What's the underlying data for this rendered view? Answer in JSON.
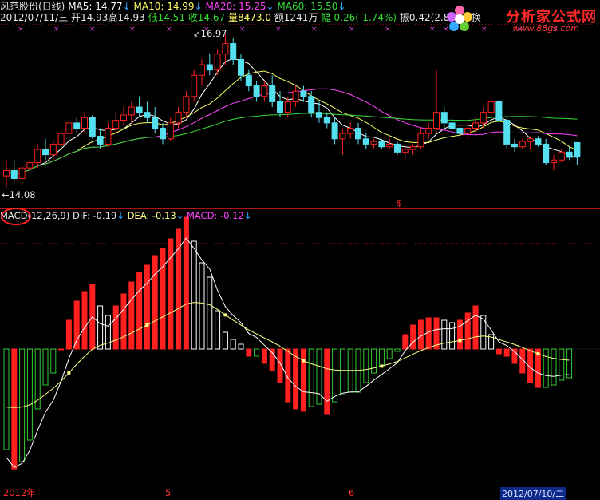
{
  "header": {
    "name": "风范股份(日线)",
    "ma5_label": "MA5: 14.77",
    "ma10_label": "MA10: 14.99",
    "ma20_label": "MA20: 15.25",
    "ma60_label": "MA60: 15.50",
    "date": "2012/07/11/三",
    "open": "开14.93",
    "high": "高14.93",
    "low": "低14.51",
    "close": "收14.67",
    "volume": "量8473.0",
    "amount": "额1241万",
    "change": "幅-0.26(-1.74%)",
    "amplitude": "振0.42(2.81%)",
    "more": "换"
  },
  "logo": {
    "title": "分析家公式网",
    "url": "www.88gs.com"
  },
  "price_panel": {
    "high_label": "16.97",
    "low_label": "←14.08",
    "marker": "$"
  },
  "macd_panel": {
    "name": "MACD",
    "params": "(12,26,9)",
    "dif_label": "DIF: -0.19",
    "dea_label": "DEA: -0.13",
    "macd_label": "MACD: -0.12"
  },
  "axis": {
    "left_date": "2012年",
    "mark_5": "5",
    "mark_6": "6",
    "right_date": "2012/07/10/二"
  },
  "colors": {
    "up": "#ff2020",
    "down": "#55e0f0",
    "ma5": "#ffffff",
    "ma10": "#ffff66",
    "ma20": "#ff44ff",
    "ma60": "#33dd33",
    "dif": "#ffffff",
    "dea": "#ffff88"
  },
  "chart_data": {
    "type": "candlestick+macd",
    "candles": [
      [
        14.3,
        14.6,
        14.08,
        14.4
      ],
      [
        14.4,
        14.6,
        14.2,
        14.25
      ],
      [
        14.25,
        14.5,
        14.1,
        14.45
      ],
      [
        14.45,
        14.7,
        14.35,
        14.55
      ],
      [
        14.55,
        14.9,
        14.45,
        14.8
      ],
      [
        14.8,
        15.0,
        14.6,
        14.7
      ],
      [
        14.7,
        15.0,
        14.6,
        14.9
      ],
      [
        14.9,
        15.2,
        14.8,
        15.1
      ],
      [
        15.1,
        15.4,
        15.0,
        15.3
      ],
      [
        15.3,
        15.4,
        15.1,
        15.2
      ],
      [
        15.2,
        15.5,
        15.1,
        15.4
      ],
      [
        15.4,
        15.45,
        15.0,
        15.05
      ],
      [
        15.05,
        15.2,
        14.8,
        14.9
      ],
      [
        14.9,
        15.3,
        14.85,
        15.2
      ],
      [
        15.2,
        15.5,
        15.1,
        15.35
      ],
      [
        15.35,
        15.6,
        15.25,
        15.45
      ],
      [
        15.45,
        15.7,
        15.3,
        15.6
      ],
      [
        15.6,
        15.8,
        15.4,
        15.5
      ],
      [
        15.5,
        15.7,
        15.3,
        15.4
      ],
      [
        15.4,
        15.6,
        15.1,
        15.2
      ],
      [
        15.2,
        15.3,
        14.9,
        15.0
      ],
      [
        15.0,
        15.4,
        14.95,
        15.3
      ],
      [
        15.3,
        15.6,
        15.2,
        15.5
      ],
      [
        15.5,
        15.9,
        15.4,
        15.8
      ],
      [
        15.8,
        16.3,
        15.7,
        16.2
      ],
      [
        16.2,
        16.5,
        16.0,
        16.4
      ],
      [
        16.4,
        16.6,
        16.2,
        16.3
      ],
      [
        16.3,
        16.7,
        16.2,
        16.6
      ],
      [
        16.6,
        16.97,
        16.4,
        16.8
      ],
      [
        16.8,
        16.9,
        16.4,
        16.5
      ],
      [
        16.5,
        16.6,
        16.1,
        16.2
      ],
      [
        16.2,
        16.3,
        15.9,
        16.0
      ],
      [
        16.0,
        16.1,
        15.7,
        15.8
      ],
      [
        15.8,
        16.1,
        15.7,
        16.0
      ],
      [
        16.0,
        16.2,
        15.6,
        15.7
      ],
      [
        15.7,
        15.9,
        15.4,
        15.5
      ],
      [
        15.5,
        15.8,
        15.4,
        15.7
      ],
      [
        15.7,
        16.0,
        15.6,
        15.9
      ],
      [
        15.9,
        16.0,
        15.7,
        15.8
      ],
      [
        15.8,
        15.9,
        15.4,
        15.5
      ],
      [
        15.5,
        15.7,
        15.3,
        15.4
      ],
      [
        15.4,
        15.5,
        15.2,
        15.3
      ],
      [
        15.3,
        15.4,
        14.9,
        15.0
      ],
      [
        15.0,
        15.2,
        14.7,
        15.1
      ],
      [
        15.1,
        15.3,
        15.0,
        15.2
      ],
      [
        15.2,
        15.3,
        14.9,
        15.0
      ],
      [
        15.0,
        15.1,
        14.8,
        14.9
      ],
      [
        14.9,
        15.0,
        14.8,
        14.95
      ],
      [
        14.95,
        15.0,
        14.8,
        14.85
      ],
      [
        14.85,
        15.0,
        14.8,
        14.9
      ],
      [
        14.9,
        14.95,
        14.7,
        14.75
      ],
      [
        14.75,
        14.85,
        14.6,
        14.8
      ],
      [
        14.8,
        14.9,
        14.7,
        14.85
      ],
      [
        14.85,
        15.2,
        14.8,
        15.1
      ],
      [
        15.1,
        15.3,
        15.0,
        15.2
      ],
      [
        15.2,
        16.3,
        15.1,
        15.5
      ],
      [
        15.5,
        15.6,
        15.2,
        15.3
      ],
      [
        15.3,
        15.4,
        15.1,
        15.2
      ],
      [
        15.2,
        15.3,
        15.0,
        15.1
      ],
      [
        15.1,
        15.3,
        15.0,
        15.2
      ],
      [
        15.2,
        15.4,
        15.1,
        15.3
      ],
      [
        15.3,
        15.6,
        15.2,
        15.5
      ],
      [
        15.5,
        15.8,
        15.4,
        15.7
      ],
      [
        15.7,
        15.75,
        15.3,
        15.35
      ],
      [
        15.35,
        15.4,
        14.8,
        14.9
      ],
      [
        14.9,
        15.0,
        14.75,
        14.85
      ],
      [
        14.85,
        15.0,
        14.8,
        14.95
      ],
      [
        14.95,
        15.05,
        14.8,
        15.0
      ],
      [
        15.0,
        15.05,
        14.85,
        14.9
      ],
      [
        14.9,
        15.0,
        14.5,
        14.55
      ],
      [
        14.55,
        14.7,
        14.4,
        14.6
      ],
      [
        14.6,
        14.8,
        14.55,
        14.75
      ],
      [
        14.75,
        14.85,
        14.6,
        14.65
      ],
      [
        14.93,
        14.93,
        14.51,
        14.67
      ]
    ],
    "macd": [
      -0.42,
      -0.5,
      -0.47,
      -0.38,
      -0.25,
      -0.15,
      -0.1,
      0.0,
      0.12,
      0.2,
      0.24,
      0.27,
      0.18,
      0.14,
      0.18,
      0.23,
      0.28,
      0.32,
      0.35,
      0.39,
      0.42,
      0.46,
      0.5,
      0.55,
      0.45,
      0.36,
      0.3,
      0.16,
      0.07,
      0.04,
      0.02,
      -0.03,
      -0.03,
      -0.06,
      -0.09,
      -0.14,
      -0.22,
      -0.25,
      -0.26,
      -0.24,
      -0.23,
      -0.27,
      -0.22,
      -0.19,
      -0.18,
      -0.18,
      -0.14,
      -0.1,
      -0.07,
      -0.04,
      -0.01,
      0.06,
      0.1,
      0.12,
      0.13,
      0.13,
      0.12,
      0.11,
      0.12,
      0.15,
      0.18,
      0.14,
      0.06,
      -0.02,
      -0.03,
      -0.06,
      -0.1,
      -0.14,
      -0.16,
      -0.16,
      -0.15,
      -0.13,
      -0.12
    ],
    "ma_periods": [
      5,
      10,
      20,
      60
    ]
  }
}
